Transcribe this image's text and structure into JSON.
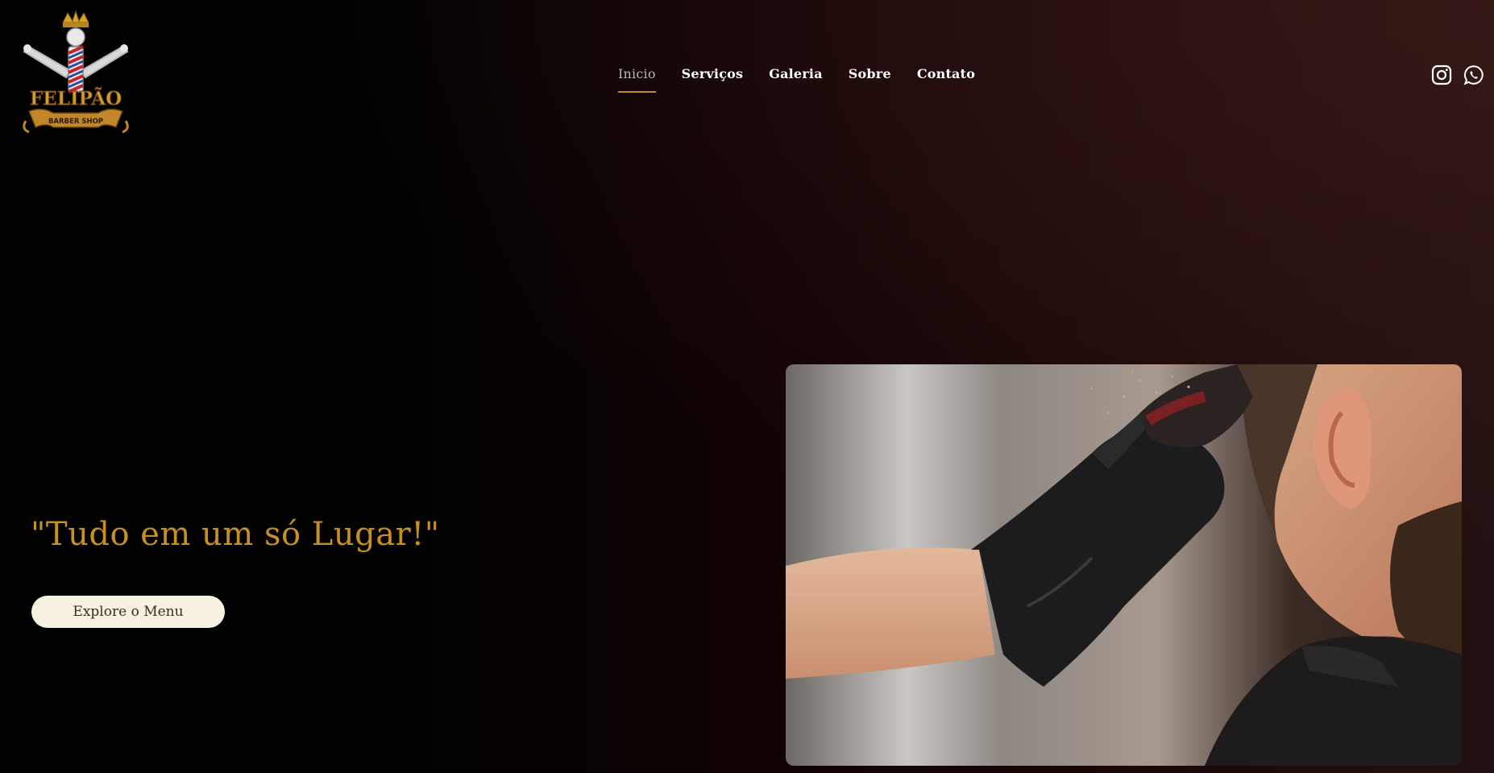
{
  "header": {
    "logo": {
      "icon": "barber-shop-logo",
      "brand_text": "FELIPÃO",
      "sub_text": "BARBER SHOP"
    },
    "nav": [
      {
        "label": "Inicio",
        "active": true
      },
      {
        "label": "Serviços",
        "active": false
      },
      {
        "label": "Galeria",
        "active": false
      },
      {
        "label": "Sobre",
        "active": false
      },
      {
        "label": "Contato",
        "active": false
      }
    ],
    "social": [
      {
        "icon": "instagram-icon"
      },
      {
        "icon": "whatsapp-icon"
      }
    ]
  },
  "hero": {
    "tagline": "\"Tudo em um só Lugar!\"",
    "cta_label": "Explore o Menu",
    "image": "barber-cutting-hair-photo"
  },
  "colors": {
    "accent_gold": "#c8911f",
    "nav_underline": "#c48a2a",
    "cta_background": "#f7f1e1",
    "background_dark": "#000000",
    "background_maroon": "#1a0707"
  }
}
